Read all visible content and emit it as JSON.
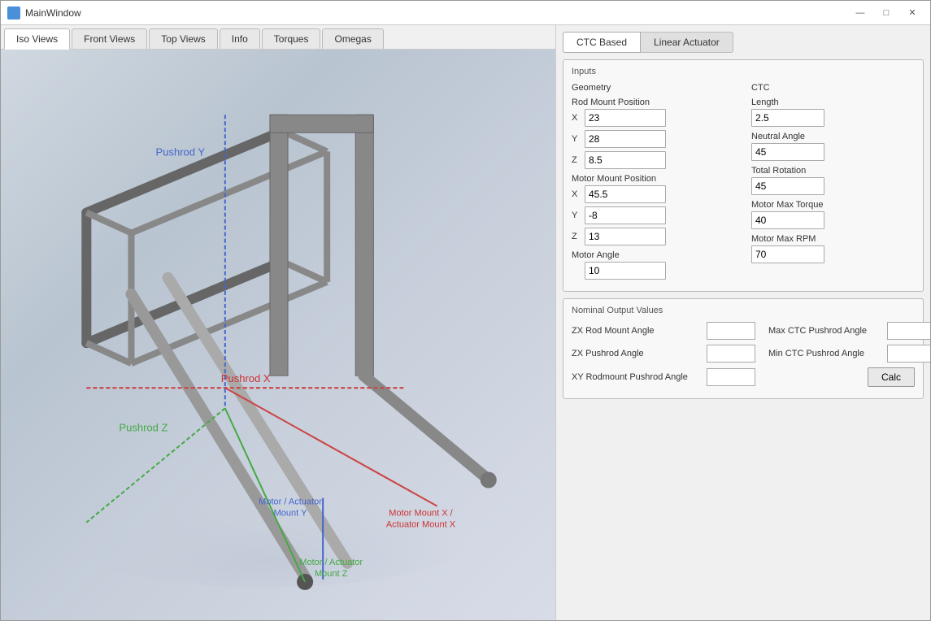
{
  "window": {
    "title": "MainWindow",
    "minimize": "—",
    "maximize": "□",
    "close": "✕"
  },
  "tabs": [
    {
      "label": "Iso Views",
      "active": true
    },
    {
      "label": "Front Views",
      "active": false
    },
    {
      "label": "Top Views",
      "active": false
    },
    {
      "label": "Info",
      "active": false
    },
    {
      "label": "Torques",
      "active": false
    },
    {
      "label": "Omegas",
      "active": false
    }
  ],
  "right_tabs": [
    {
      "label": "CTC Based",
      "active": true
    },
    {
      "label": "Linear Actuator",
      "active": false
    }
  ],
  "inputs_panel": {
    "title": "Inputs",
    "geometry_section": "Geometry",
    "ctc_section": "CTC",
    "rod_mount_position_label": "Rod Mount Position",
    "rod_x": "23",
    "rod_y": "28",
    "rod_z": "8.5",
    "motor_mount_position_label": "Motor Mount Position",
    "motor_x": "45.5",
    "motor_y": "-8",
    "motor_z": "13",
    "motor_angle_label": "Motor Angle",
    "motor_angle": "10",
    "ctc_length_label": "Length",
    "ctc_length": "2.5",
    "neutral_angle_label": "Neutral Angle",
    "neutral_angle": "45",
    "total_rotation_label": "Total Rotation",
    "total_rotation": "45",
    "motor_max_torque_label": "Motor Max Torque",
    "motor_max_torque": "40",
    "motor_max_rpm_label": "Motor Max RPM",
    "motor_max_rpm": "70"
  },
  "nominal_panel": {
    "title": "Nominal Output Values",
    "zx_rod_mount_angle_label": "ZX Rod Mount Angle",
    "zx_rod_mount_angle": "",
    "max_ctc_pushrod_label": "Max CTC Pushrod Angle",
    "max_ctc_pushrod": "",
    "zx_pushrod_angle_label": "ZX Pushrod Angle",
    "zx_pushrod_angle": "",
    "min_ctc_pushrod_label": "Min CTC Pushrod Angle",
    "min_ctc_pushrod": "",
    "xy_rodmount_label": "XY Rodmount Pushrod Angle",
    "xy_rodmount": "",
    "calc_label": "Calc"
  },
  "viewport_labels": {
    "pushrod_y": "Pushrod Y",
    "pushrod_x": "Pushrod X",
    "pushrod_z": "Pushrod Z",
    "motor_actuator_mount_y": "Motor / Actuator\nMount Y",
    "motor_mount_x": "Motor Mount X /\nActuator Mount X",
    "motor_actuator_mount_z": "Motor / Actuator\nMount Z"
  }
}
